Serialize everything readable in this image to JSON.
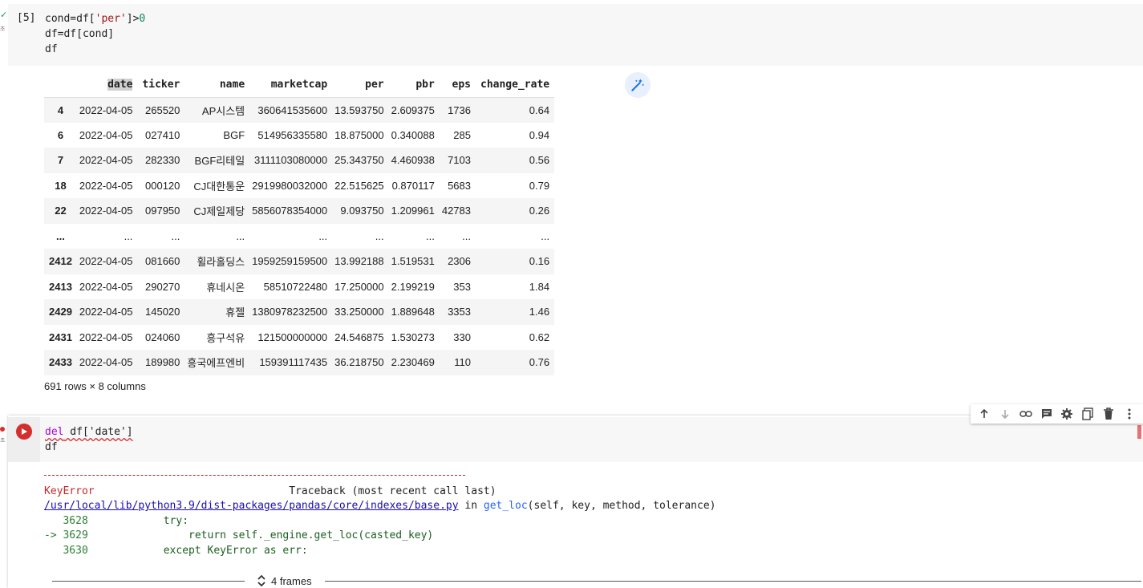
{
  "cell1": {
    "exec_count": "[5]",
    "code": [
      {
        "parts": [
          {
            "t": "cond=df[",
            "c": ""
          },
          {
            "t": "'per'",
            "c": "str"
          },
          {
            "t": "]>",
            "c": ""
          },
          {
            "t": "0",
            "c": "num"
          }
        ]
      },
      {
        "parts": [
          {
            "t": "df=df[cond]",
            "c": ""
          }
        ]
      },
      {
        "parts": [
          {
            "t": "df",
            "c": ""
          }
        ]
      }
    ]
  },
  "dataframe": {
    "columns": [
      "date",
      "ticker",
      "name",
      "marketcap",
      "per",
      "pbr",
      "eps",
      "change_rate"
    ],
    "rows": [
      {
        "index": "4",
        "cells": [
          "2022-04-05",
          "265520",
          "AP시스템",
          "360641535600",
          "13.593750",
          "2.609375",
          "1736",
          "0.64"
        ]
      },
      {
        "index": "6",
        "cells": [
          "2022-04-05",
          "027410",
          "BGF",
          "514956335580",
          "18.875000",
          "0.340088",
          "285",
          "0.94"
        ]
      },
      {
        "index": "7",
        "cells": [
          "2022-04-05",
          "282330",
          "BGF리테일",
          "3111103080000",
          "25.343750",
          "4.460938",
          "7103",
          "0.56"
        ]
      },
      {
        "index": "18",
        "cells": [
          "2022-04-05",
          "000120",
          "CJ대한통운",
          "2919980032000",
          "22.515625",
          "0.870117",
          "5683",
          "0.79"
        ]
      },
      {
        "index": "22",
        "cells": [
          "2022-04-05",
          "097950",
          "CJ제일제당",
          "5856078354000",
          "9.093750",
          "1.209961",
          "42783",
          "0.26"
        ]
      },
      {
        "index": "...",
        "cells": [
          "...",
          "...",
          "...",
          "...",
          "...",
          "...",
          "...",
          "..."
        ]
      },
      {
        "index": "2412",
        "cells": [
          "2022-04-05",
          "081660",
          "휠라홀딩스",
          "1959259159500",
          "13.992188",
          "1.519531",
          "2306",
          "0.16"
        ]
      },
      {
        "index": "2413",
        "cells": [
          "2022-04-05",
          "290270",
          "휴네시온",
          "58510722480",
          "17.250000",
          "2.199219",
          "353",
          "1.84"
        ]
      },
      {
        "index": "2429",
        "cells": [
          "2022-04-05",
          "145020",
          "휴젤",
          "1380978232500",
          "33.250000",
          "1.889648",
          "3353",
          "1.46"
        ]
      },
      {
        "index": "2431",
        "cells": [
          "2022-04-05",
          "024060",
          "흥구석유",
          "121500000000",
          "24.546875",
          "1.530273",
          "330",
          "0.62"
        ]
      },
      {
        "index": "2433",
        "cells": [
          "2022-04-05",
          "189980",
          "흥국에프엔비",
          "159391117435",
          "36.218750",
          "2.230469",
          "110",
          "0.76"
        ]
      }
    ],
    "shape": "691 rows × 8 columns"
  },
  "cell2": {
    "code_line1_kw": "del",
    "code_line1_rest": " df['date']",
    "code_line2": "df",
    "toolbar_icons": [
      "arrow-up-icon",
      "arrow-down-icon",
      "link-icon",
      "comment-icon",
      "settings-icon",
      "mirror-cell-icon",
      "trash-icon",
      "more-icon"
    ]
  },
  "traceback": {
    "error_name": "KeyError",
    "header_right": "Traceback (most recent call last)",
    "file_link": "/usr/local/lib/python3.9/dist-packages/pandas/core/indexes/base.py",
    "in_word": " in ",
    "func_name": "get_loc",
    "func_args": "(self, key, method, tolerance)",
    "lines": [
      {
        "prefix": "   3628",
        "code": "            try:"
      },
      {
        "prefix": "-> 3629",
        "code": "                return self._engine.get_loc(casted_key)"
      },
      {
        "prefix": "   3630",
        "code": "            except KeyError as err:"
      }
    ],
    "frames_label": "4 frames"
  },
  "colors": {
    "error_red": "#c62828",
    "run_button": "#d32f2f",
    "link": "#1a0dab",
    "string": "#a31515"
  }
}
